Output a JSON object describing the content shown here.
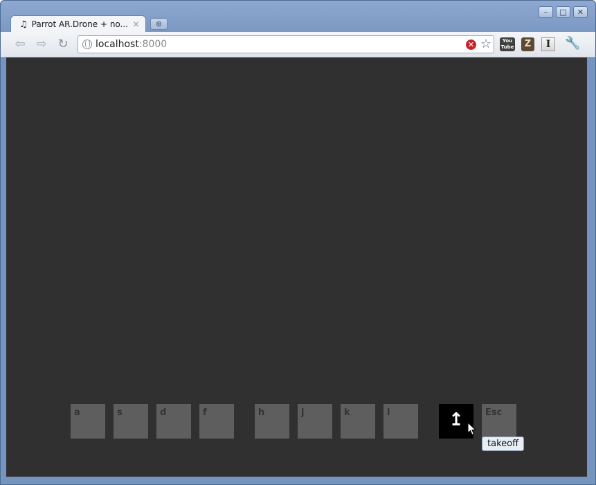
{
  "browser": {
    "tab": {
      "icon": "music-note-icon",
      "title": "Parrot AR.Drone + no...",
      "close_glyph": "×"
    },
    "new_tab_glyph": "⊕",
    "window_controls": [
      "–",
      "□",
      "✕"
    ],
    "nav": {
      "back": "⇦",
      "forward": "⇨",
      "reload": "↻"
    },
    "address": {
      "host": "localhost",
      "port": ":8000"
    },
    "extensions": {
      "youtube_line1": "You",
      "youtube_line2": "Tube",
      "z_label": "Z",
      "i_label": "I"
    }
  },
  "page": {
    "background": "#303030",
    "keys": [
      {
        "label": "a"
      },
      {
        "label": "s"
      },
      {
        "label": "d"
      },
      {
        "label": "f"
      },
      {
        "label": "h"
      },
      {
        "label": "j"
      },
      {
        "label": "k"
      },
      {
        "label": "l"
      },
      {
        "label": "↥",
        "icon": "arrow-up-icon",
        "active": true
      },
      {
        "label": "Esc"
      }
    ],
    "tooltip": "takeoff"
  }
}
